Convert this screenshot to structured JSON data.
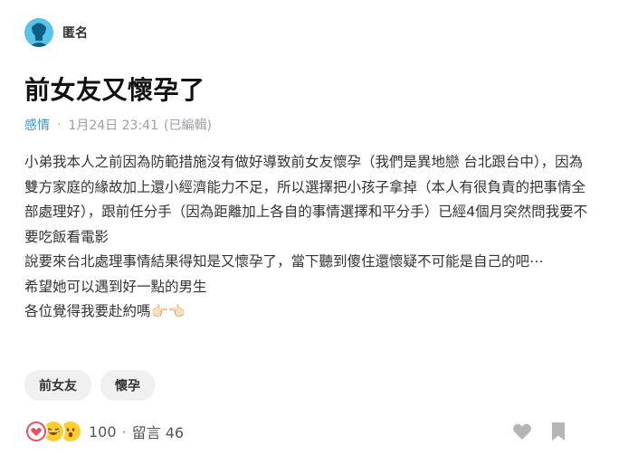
{
  "author": {
    "name": "匿名",
    "avatar_icon": "anonymous-avatar-icon"
  },
  "post": {
    "title": "前女友又懷孕了",
    "forum": "感情",
    "date": "1月24日 23:41",
    "edited": "(已編輯)",
    "content": [
      "小弟我本人之前因為防範措施沒有做好導致前女友懷孕（我們是異地戀 台北跟台中），因為雙方家庭的緣故加上還小經濟能力不足，所以選擇把小孩子拿掉（本人有很負責的把事情全部處理好），跟前任分手（因為距離加上各自的事情選擇和平分手）已經4個月突然問我要不要吃飯看電影",
      "說要來台北處理事情結果得知是又懷孕了，當下聽到傻住還懷疑不可能是自己的吧⋯",
      "希望她可以遇到好一點的男生",
      "各位覺得我要赴約嗎👉🏻👈🏻"
    ],
    "tags": [
      "前女友",
      "懷孕"
    ]
  },
  "footer": {
    "reactions": [
      "heart-reaction-icon",
      "laugh-reaction-icon",
      "wow-reaction-icon"
    ],
    "reaction_count": "100",
    "separator": "·",
    "comments": "留言 46",
    "like_icon": "heart-outline-icon",
    "bookmark_icon": "bookmark-icon"
  },
  "colors": {
    "forum": "#3397cf",
    "avatar": "#59c3ea",
    "muted": "#9aa0a6",
    "heart": "#e84f5f",
    "reaction_yellow": "#ffcd2e",
    "action_gray": "#b5b5b5"
  }
}
